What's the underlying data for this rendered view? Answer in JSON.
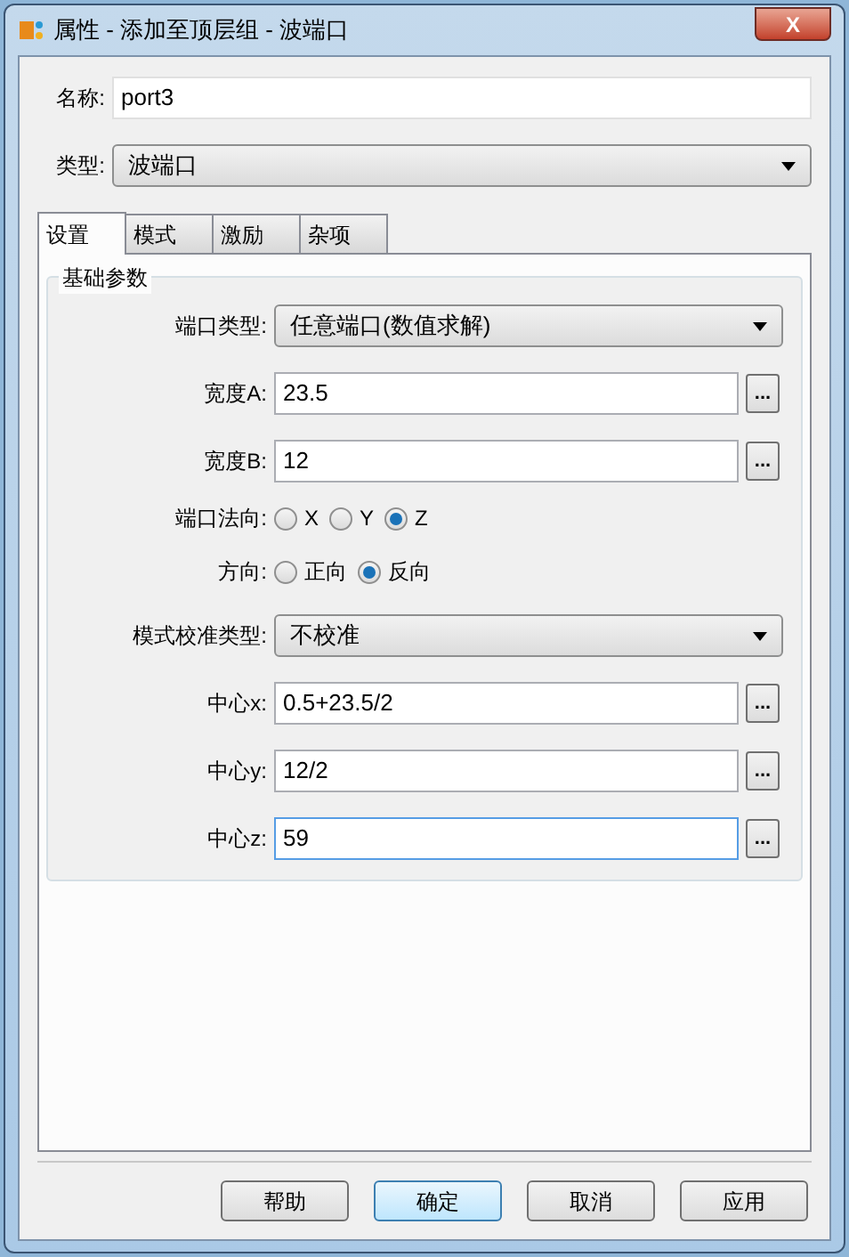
{
  "window": {
    "title": "属性 - 添加至顶层组 - 波端口",
    "close": "X"
  },
  "name_field": {
    "label": "名称:",
    "value": "port3"
  },
  "type_field": {
    "label": "类型:",
    "value": "波端口"
  },
  "tabs": [
    {
      "label": "设置",
      "selected": true
    },
    {
      "label": "模式",
      "selected": false
    },
    {
      "label": "激励",
      "selected": false
    },
    {
      "label": "杂项",
      "selected": false
    }
  ],
  "group": {
    "title": "基础参数",
    "rows": [
      {
        "kind": "select",
        "label": "端口类型:",
        "value": "任意端口(数值求解)"
      },
      {
        "kind": "input",
        "label": "宽度A:",
        "value": "23.5",
        "button": "...",
        "focused": false
      },
      {
        "kind": "input",
        "label": "宽度B:",
        "value": "12",
        "button": "...",
        "focused": false
      },
      {
        "kind": "radio",
        "label": "端口法向:",
        "options": [
          {
            "label": "X",
            "selected": false
          },
          {
            "label": "Y",
            "selected": false
          },
          {
            "label": "Z",
            "selected": true
          }
        ]
      },
      {
        "kind": "radio",
        "label": "方向:",
        "options": [
          {
            "label": "正向",
            "selected": false
          },
          {
            "label": "反向",
            "selected": true
          }
        ]
      },
      {
        "kind": "select",
        "label": "模式校准类型:",
        "value": "不校准"
      },
      {
        "kind": "input",
        "label": "中心x:",
        "value": "0.5+23.5/2",
        "button": "...",
        "focused": false
      },
      {
        "kind": "input",
        "label": "中心y:",
        "value": "12/2",
        "button": "...",
        "focused": false
      },
      {
        "kind": "input",
        "label": "中心z:",
        "value": "59",
        "button": "...",
        "focused": true
      }
    ]
  },
  "buttons": [
    {
      "label": "帮助",
      "default": false
    },
    {
      "label": "确定",
      "default": true
    },
    {
      "label": "取消",
      "default": false
    },
    {
      "label": "应用",
      "default": false
    }
  ]
}
